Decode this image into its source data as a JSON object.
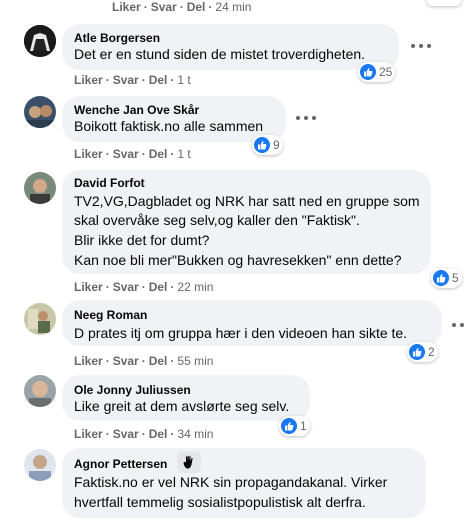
{
  "labels": {
    "like": "Liker",
    "reply": "Svar",
    "share": "Del",
    "sep": "·"
  },
  "top": {
    "time": "24 min"
  },
  "comments": [
    {
      "author": "Atle Borgersen",
      "lines": [
        "Det er en stund siden de mistet troverdigheten."
      ],
      "reactions": "25",
      "time": "1 t"
    },
    {
      "author": "Wenche Jan Ove Skår",
      "lines": [
        "Boikott faktisk.no alle sammen"
      ],
      "reactions": "9",
      "time": "1 t"
    },
    {
      "author": "David Forfot",
      "lines": [
        "TV2,VG,Dagbladet og NRK har satt ned en gruppe som",
        "skal overvåke seg selv,og kaller den \"Faktisk\".",
        "Blir ikke det for dumt?",
        "Kan noe bli mer\"Bukken og havresekken\" enn dette?"
      ],
      "reactions": "5",
      "time": "22 min"
    },
    {
      "author": "Neeg Roman",
      "lines": [
        "D prates itj om gruppa hær i den videoen han sikte te."
      ],
      "reactions": "2",
      "time": "55 min"
    },
    {
      "author": "Ole Jonny Juliussen",
      "lines": [
        "Like greit at dem avslørte seg selv."
      ],
      "reactions": "1",
      "time": "34 min"
    },
    {
      "author": "Agnor Pettersen",
      "lines": [
        "Faktisk.no er vel NRK sin propagandakanal. Virker",
        "hvertfall temmelig sosialistpopulistisk alt derfra."
      ],
      "reactions": "",
      "time": ""
    }
  ],
  "colors": {
    "bubble": "#f0f2f5",
    "meta": "#65676b",
    "like": "#1877f2"
  },
  "icons": {
    "like": "like-icon",
    "more": "more-icon",
    "badge": "wave-hand-icon"
  }
}
